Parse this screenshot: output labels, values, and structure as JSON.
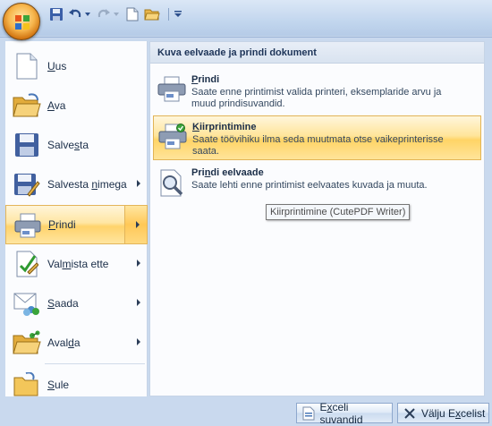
{
  "quick_access": {
    "office_button": "office-button",
    "save": "save-icon",
    "undo": "undo-icon",
    "redo": "redo-icon",
    "new": "new-document-icon",
    "open": "open-folder-icon",
    "customize": "customize-qat-icon"
  },
  "left_menu": {
    "items": [
      {
        "pre": "",
        "key": "U",
        "post": "us",
        "icon": "new-document-icon",
        "submenu": false
      },
      {
        "pre": "",
        "key": "A",
        "post": "va",
        "icon": "open-folder-icon",
        "submenu": false
      },
      {
        "pre": "Salve",
        "key": "s",
        "post": "ta",
        "icon": "save-icon",
        "submenu": false
      },
      {
        "pre": "Salvesta ",
        "key": "n",
        "post": "imega",
        "icon": "save-as-icon",
        "submenu": true
      },
      {
        "pre": "",
        "key": "P",
        "post": "rindi",
        "icon": "printer-icon",
        "submenu": true
      },
      {
        "pre": "Val",
        "key": "m",
        "post": "ista ette",
        "icon": "prepare-icon",
        "submenu": true
      },
      {
        "pre": "",
        "key": "S",
        "post": "aada",
        "icon": "send-icon",
        "submenu": true
      },
      {
        "pre": "Aval",
        "key": "d",
        "post": "a",
        "icon": "publish-icon",
        "submenu": true
      },
      {
        "pre": "",
        "key": "S",
        "post": "ule",
        "icon": "close-folder-icon",
        "submenu": false
      }
    ]
  },
  "submenu": {
    "header": "Kuva eelvaade ja prindi dokument",
    "items": [
      {
        "title_pre": "",
        "title_key": "P",
        "title_post": "rindi",
        "desc": "Saate enne printimist valida printeri, eksemplaride arvu ja muud prindisuvandid.",
        "icon": "printer-icon"
      },
      {
        "title_pre": "",
        "title_key": "K",
        "title_post": "iirprintimine",
        "desc": "Saate töövihiku ilma seda muutmata otse vaikeprinterisse saata.",
        "icon": "quick-print-icon"
      },
      {
        "title_pre": "Pri",
        "title_key": "n",
        "title_post": "di eelvaade",
        "desc": "Saate lehti enne printimist eelvaates kuvada ja muuta.",
        "icon": "print-preview-icon"
      }
    ]
  },
  "tooltip": "Kiirprintimine (CutePDF Writer)",
  "bottom": {
    "options_pre": "E",
    "options_key": "x",
    "options_post": "celi suvandid",
    "exit_pre": "Välju E",
    "exit_key": "x",
    "exit_post": "celist"
  },
  "colors": {
    "highlight": "#ffd36b",
    "pane_bg": "#fbfcfe",
    "frame_bg": "#c9d9ee"
  }
}
